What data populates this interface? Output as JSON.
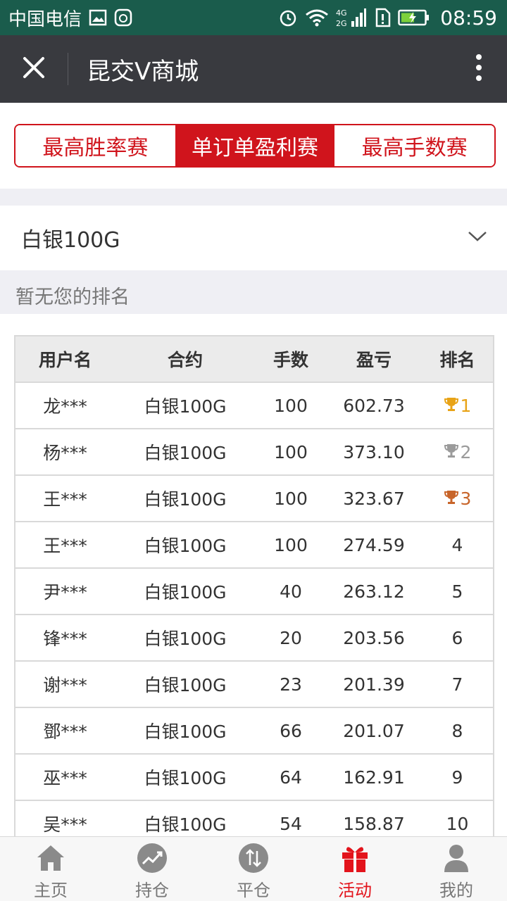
{
  "status_bar": {
    "carrier": "中国电信",
    "network": "4G 2G",
    "time": "08:59"
  },
  "header": {
    "title": "昆交V商城"
  },
  "tabs": [
    {
      "label": "最高胜率赛",
      "active": false
    },
    {
      "label": "单订单盈利赛",
      "active": true
    },
    {
      "label": "最高手数赛",
      "active": false
    }
  ],
  "product_select": {
    "value": "白银100G"
  },
  "rank_note": "暂无您的排名",
  "table": {
    "headers": [
      "用户名",
      "合约",
      "手数",
      "盈亏",
      "排名"
    ],
    "rows": [
      {
        "user": "龙***",
        "contract": "白银100G",
        "lots": "100",
        "pnl": "602.73",
        "rank": "1",
        "trophy": "gold"
      },
      {
        "user": "杨***",
        "contract": "白银100G",
        "lots": "100",
        "pnl": "373.10",
        "rank": "2",
        "trophy": "silver"
      },
      {
        "user": "王***",
        "contract": "白银100G",
        "lots": "100",
        "pnl": "323.67",
        "rank": "3",
        "trophy": "bronze"
      },
      {
        "user": "王***",
        "contract": "白银100G",
        "lots": "100",
        "pnl": "274.59",
        "rank": "4",
        "trophy": ""
      },
      {
        "user": "尹***",
        "contract": "白银100G",
        "lots": "40",
        "pnl": "263.12",
        "rank": "5",
        "trophy": ""
      },
      {
        "user": "锋***",
        "contract": "白银100G",
        "lots": "20",
        "pnl": "203.56",
        "rank": "6",
        "trophy": ""
      },
      {
        "user": "谢***",
        "contract": "白银100G",
        "lots": "23",
        "pnl": "201.39",
        "rank": "7",
        "trophy": ""
      },
      {
        "user": "鄧***",
        "contract": "白银100G",
        "lots": "66",
        "pnl": "201.07",
        "rank": "8",
        "trophy": ""
      },
      {
        "user": "巫***",
        "contract": "白银100G",
        "lots": "64",
        "pnl": "162.91",
        "rank": "9",
        "trophy": ""
      },
      {
        "user": "吴***",
        "contract": "白银100G",
        "lots": "54",
        "pnl": "158.87",
        "rank": "10",
        "trophy": ""
      }
    ]
  },
  "bottom_nav": [
    {
      "label": "主页",
      "icon": "home-icon",
      "active": false
    },
    {
      "label": "持仓",
      "icon": "chart-trend-icon",
      "active": false
    },
    {
      "label": "平仓",
      "icon": "up-down-arrows-icon",
      "active": false
    },
    {
      "label": "活动",
      "icon": "gift-icon",
      "active": true
    },
    {
      "label": "我的",
      "icon": "user-icon",
      "active": false
    }
  ],
  "colors": {
    "accent": "#d0141c",
    "status_bar": "#1a5c4c",
    "app_bar": "#393a3f",
    "gold": "#e8a317",
    "silver": "#9b9b9b",
    "bronze": "#c8652a"
  }
}
